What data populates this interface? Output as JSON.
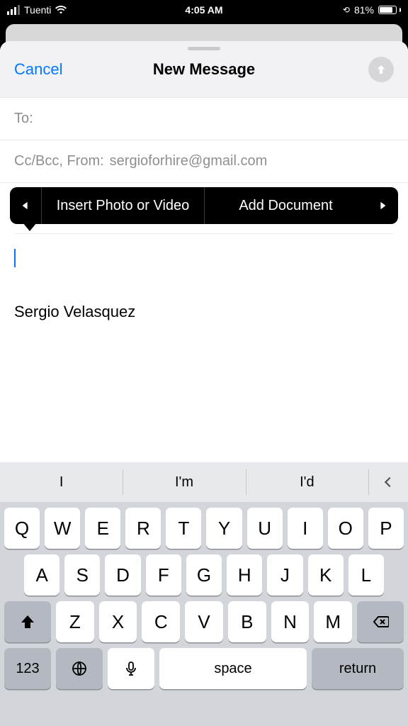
{
  "statusbar": {
    "carrier": "Tuenti",
    "time": "4:05 AM",
    "battery_pct": "81%",
    "battery_fill_pct": 81
  },
  "sheet": {
    "cancel": "Cancel",
    "title": "New Message"
  },
  "fields": {
    "to_label": "To:",
    "to_value": "",
    "ccbcc_label": "Cc/Bcc, From:",
    "from_value": "sergioforhire@gmail.com"
  },
  "popover": {
    "insert_photo": "Insert Photo or Video",
    "add_document": "Add Document"
  },
  "body": {
    "signature": "Sergio Velasquez"
  },
  "suggestions": [
    "I",
    "I'm",
    "I'd"
  ],
  "keyboard": {
    "row1": [
      "Q",
      "W",
      "E",
      "R",
      "T",
      "Y",
      "U",
      "I",
      "O",
      "P"
    ],
    "row2": [
      "A",
      "S",
      "D",
      "F",
      "G",
      "H",
      "J",
      "K",
      "L"
    ],
    "row3": [
      "Z",
      "X",
      "C",
      "V",
      "B",
      "N",
      "M"
    ],
    "numkey": "123",
    "space": "space",
    "return": "return"
  }
}
